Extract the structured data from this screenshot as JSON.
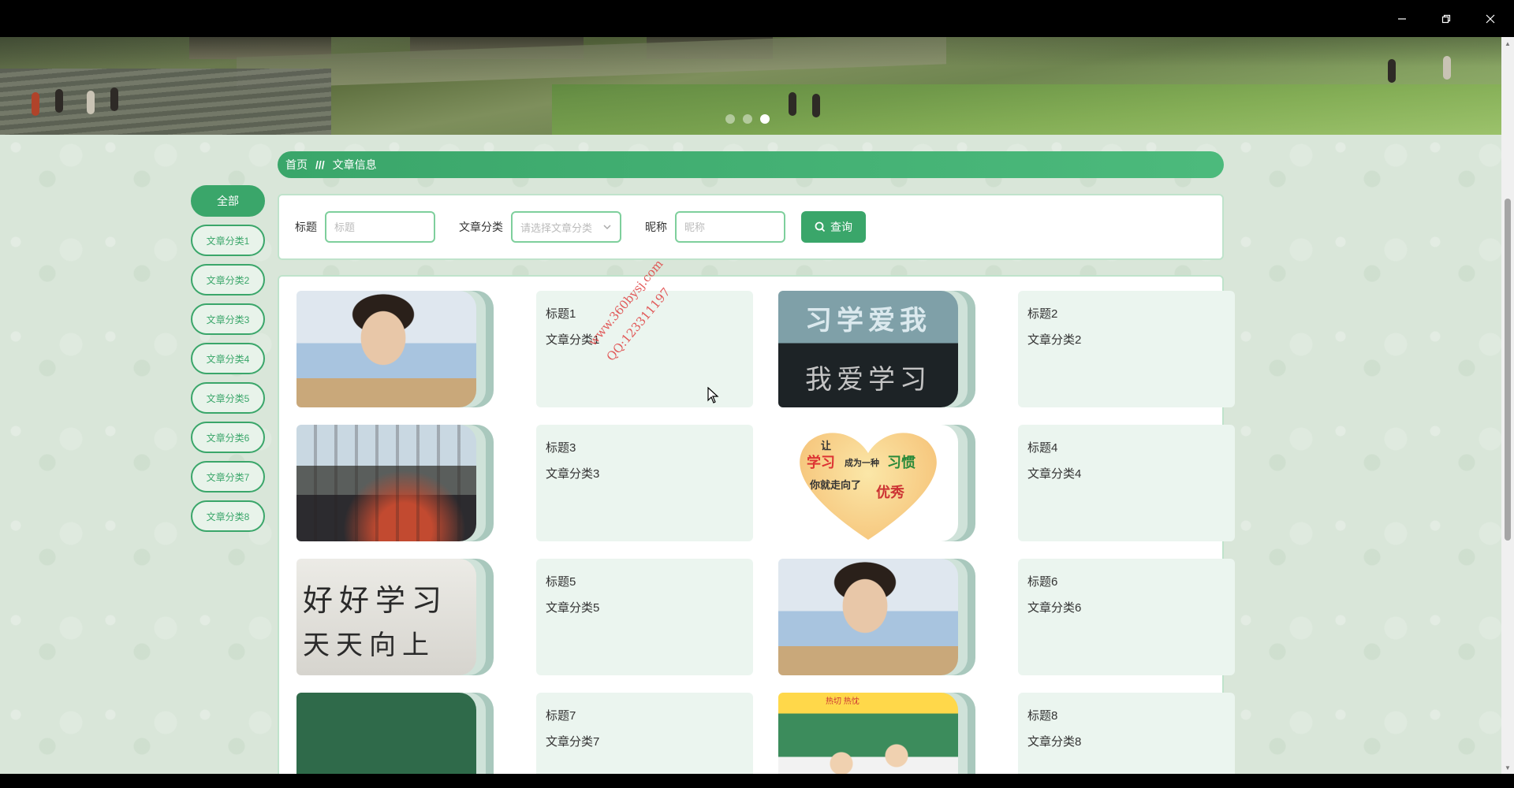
{
  "window": {
    "minimize_label": "minimize",
    "maximize_label": "restore",
    "close_label": "close"
  },
  "banner": {
    "slide_count": 3,
    "active_slide": 3
  },
  "breadcrumb": {
    "home": "首页",
    "separator": "///",
    "current": "文章信息"
  },
  "categories": {
    "all": "全部",
    "items": [
      "文章分类1",
      "文章分类2",
      "文章分类3",
      "文章分类4",
      "文章分类5",
      "文章分类6",
      "文章分类7",
      "文章分类8"
    ]
  },
  "search": {
    "title_label": "标题",
    "title_placeholder": "标题",
    "category_label": "文章分类",
    "category_placeholder": "请选择文章分类",
    "nickname_label": "昵称",
    "nickname_placeholder": "昵称",
    "button_label": "查询"
  },
  "articles": [
    {
      "title": "标题1",
      "category": "文章分类1",
      "image": "classroom-girl-writing"
    },
    {
      "title": "标题2",
      "category": "文章分类2",
      "image": "i-love-learning-stamp"
    },
    {
      "title": "标题3",
      "category": "文章分类3",
      "image": "classroom-students"
    },
    {
      "title": "标题4",
      "category": "文章分类4",
      "image": "heart-poster"
    },
    {
      "title": "标题5",
      "category": "文章分类5",
      "image": "handwriting"
    },
    {
      "title": "标题6",
      "category": "文章分类6",
      "image": "classroom-girl-writing"
    },
    {
      "title": "标题7",
      "category": "文章分类7",
      "image": "chalkboard"
    },
    {
      "title": "标题8",
      "category": "文章分类8",
      "image": "classroom-kids"
    }
  ],
  "image_text": {
    "stamp_top": "习学爱我",
    "stamp_bottom": "我爱学习",
    "heart_1": "让",
    "heart_2": "学习",
    "heart_3": "成为一种",
    "heart_4": "习惯",
    "heart_5": "你就走向了",
    "heart_6": "优秀",
    "hand_1": "好好学习",
    "hand_2": "天天向上",
    "kids_banner": "热切 热忱"
  },
  "watermark": {
    "line1": "www.360bysj.com",
    "line2": "QQ:123311197"
  },
  "colors": {
    "accent": "#3aa66a",
    "card_bg": "#ebf5ef",
    "watermark": "#e04a4a"
  }
}
